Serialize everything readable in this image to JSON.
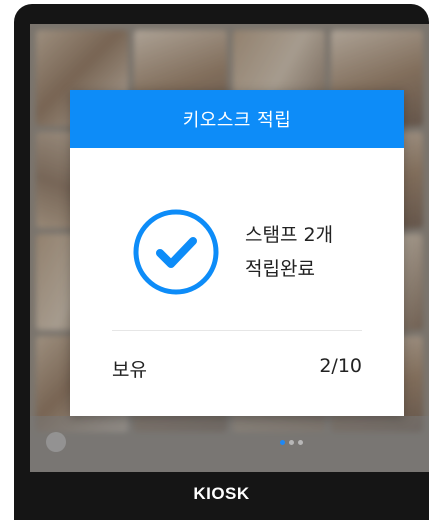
{
  "modal": {
    "title": "키오스크 적립",
    "message_line1": "스탬프 2개",
    "message_line2": "적립완료",
    "owned_label": "보유",
    "owned_value": "2/10",
    "status_icon": "check-circle-icon"
  },
  "device": {
    "label": "KIOSK"
  },
  "pager": {
    "pages": 3,
    "active_page": 1
  },
  "colors": {
    "accent": "#0d8cf8",
    "bezel": "#151515"
  }
}
